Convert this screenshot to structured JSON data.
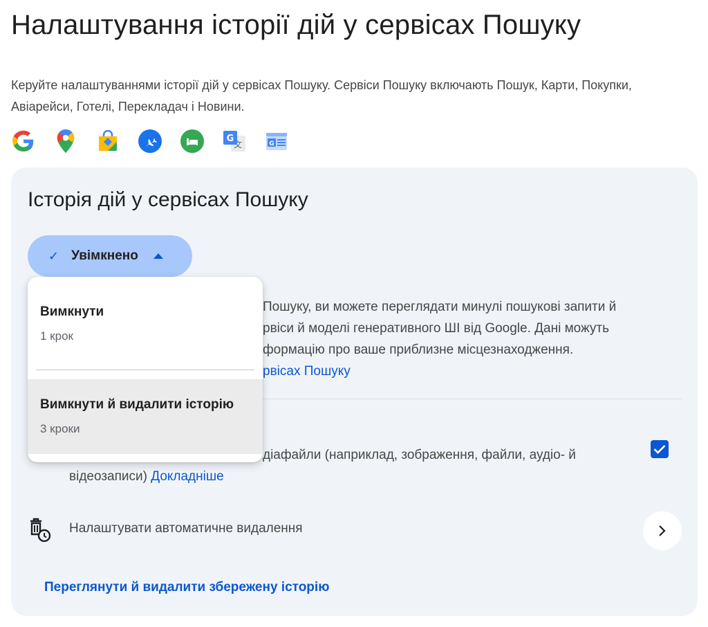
{
  "page": {
    "title": "Налаштування історії дій у сервісах Пошуку",
    "intro": "Керуйте налаштуваннями історії дій у сервісах Пошуку. Сервіси Пошуку включають Пошук, Карти, Покупки, Авіарейси, Готелі, Перекладач і Новини."
  },
  "product_icons": [
    "google-icon",
    "maps-icon",
    "shopping-icon",
    "flights-icon",
    "hotels-icon",
    "translate-icon",
    "news-icon"
  ],
  "card": {
    "title": "Історія дій у сервісах Пошуку",
    "status_label": "Увімкнено",
    "description_visible": "Пошуку, ви можете переглядати минулі пошукові запити й\nрвіси й моделі генеративного ШІ від Google. Дані можуть\nформацію про ваше приблизне місцезнаходження.",
    "description_link": "рвісах Пошуку",
    "media_text": "діафайли (наприклад, зображення, файли, аудіо- й відеозаписи)",
    "media_link": "Докладніше",
    "media_checked": true,
    "auto_delete_label": "Налаштувати автоматичне видалення",
    "manage_link": "Переглянути й видалити збережену історію"
  },
  "dropdown": {
    "items": [
      {
        "title": "Вимкнути",
        "subtitle": "1 крок"
      },
      {
        "title": "Вимкнути й видалити історію",
        "subtitle": "3 кроки"
      }
    ]
  },
  "colors": {
    "accent": "#0b57d0",
    "chip_bg": "#a8c7fa",
    "card_bg": "#f0f4f9"
  }
}
